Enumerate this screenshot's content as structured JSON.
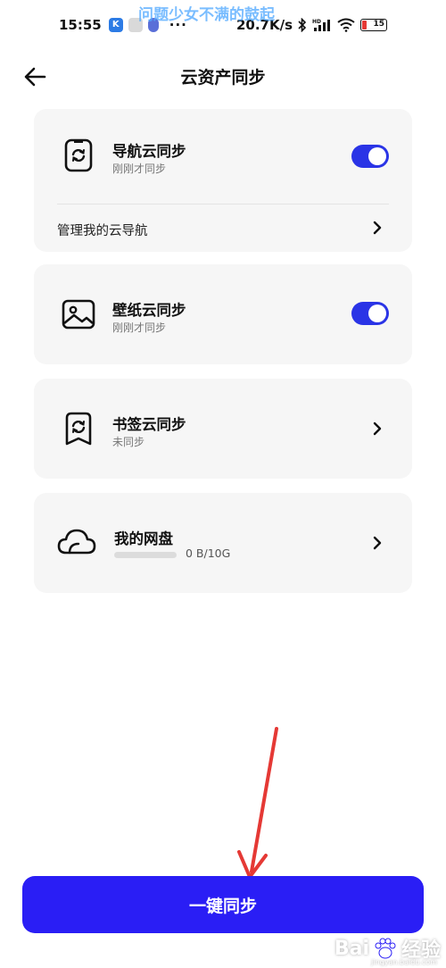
{
  "status_bar": {
    "time": "15:55",
    "network_speed": "20.7K/s",
    "battery_level": "15",
    "hd_label": "HD",
    "dots": "···"
  },
  "watermark_top": "问题少女不满的鼓起",
  "header": {
    "title": "云资产同步"
  },
  "cards": {
    "nav": {
      "title": "导航云同步",
      "subtitle": "刚刚才同步",
      "toggle_on": true,
      "manage_label": "管理我的云导航"
    },
    "wallpaper": {
      "title": "壁纸云同步",
      "subtitle": "刚刚才同步",
      "toggle_on": true
    },
    "bookmark": {
      "title": "书签云同步",
      "subtitle": "未同步"
    },
    "drive": {
      "title": "我的网盘",
      "usage": "0 B/10G",
      "usage_fraction": 0
    }
  },
  "sync_button": {
    "label": "一键同步"
  },
  "watermark_bottom": {
    "brand": "Bai",
    "brand_tail": "经验",
    "url": "jingyan.baidu.com"
  },
  "colors": {
    "accent": "#2a1ef5",
    "toggle": "#2a34e6",
    "card_bg": "#f6f6f6",
    "annotation_arrow": "#e53935"
  }
}
